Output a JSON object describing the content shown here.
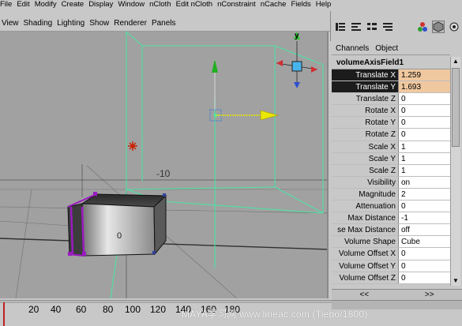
{
  "main_menu": [
    "File",
    "Edit",
    "Modify",
    "Create",
    "Display",
    "Window",
    "nCloth",
    "Edit nCloth",
    "nConstraint",
    "nCache",
    "Fields",
    "Help"
  ],
  "viewport_menu": [
    "View",
    "Shading",
    "Lighting",
    "Show",
    "Renderer",
    "Panels"
  ],
  "viewport": {
    "grid_label": "-10",
    "cube_label": "0",
    "axis_label": "y"
  },
  "channel_box": {
    "menu": [
      "Channels",
      "Object"
    ],
    "node_name": "volumeAxisField1",
    "attributes": [
      {
        "name": "Translate X",
        "value": "1.259",
        "selected": true
      },
      {
        "name": "Translate Y",
        "value": "1.693",
        "selected": true
      },
      {
        "name": "Translate Z",
        "value": "0"
      },
      {
        "name": "Rotate X",
        "value": "0"
      },
      {
        "name": "Rotate Y",
        "value": "0"
      },
      {
        "name": "Rotate Z",
        "value": "0"
      },
      {
        "name": "Scale X",
        "value": "1"
      },
      {
        "name": "Scale Y",
        "value": "1"
      },
      {
        "name": "Scale Z",
        "value": "1"
      },
      {
        "name": "Visibility",
        "value": "on"
      },
      {
        "name": "Magnitude",
        "value": "2"
      },
      {
        "name": "Attenuation",
        "value": "0"
      },
      {
        "name": "Max Distance",
        "value": "-1"
      },
      {
        "name": "se Max Distance",
        "value": "off"
      },
      {
        "name": "Volume Shape",
        "value": "Cube"
      },
      {
        "name": "Volume Offset X",
        "value": "0"
      },
      {
        "name": "Volume Offset Y",
        "value": "0"
      },
      {
        "name": "Volume Offset Z",
        "value": "0"
      }
    ]
  },
  "lower_nav": [
    "<<",
    ">>"
  ],
  "timeline": {
    "ticks": [
      "20",
      "40",
      "60",
      "80",
      "100",
      "120",
      "140",
      "160",
      "180"
    ]
  },
  "watermark": "MAYA学习网 www.lineac.com (Tiebo/1800)",
  "colors": {
    "viewport_bg": "#a1a1a1",
    "grid_green": "#55e0a0",
    "selected_field": "#f0c8a0",
    "field_arrow": "#e8e800",
    "cube_edge": "#9a1ac0"
  },
  "icons": [
    "channel-box-icon",
    "attribute-editor-icon",
    "tool-settings-icon",
    "layer-editor-icon",
    "shading-icon",
    "viewcube-icon"
  ]
}
